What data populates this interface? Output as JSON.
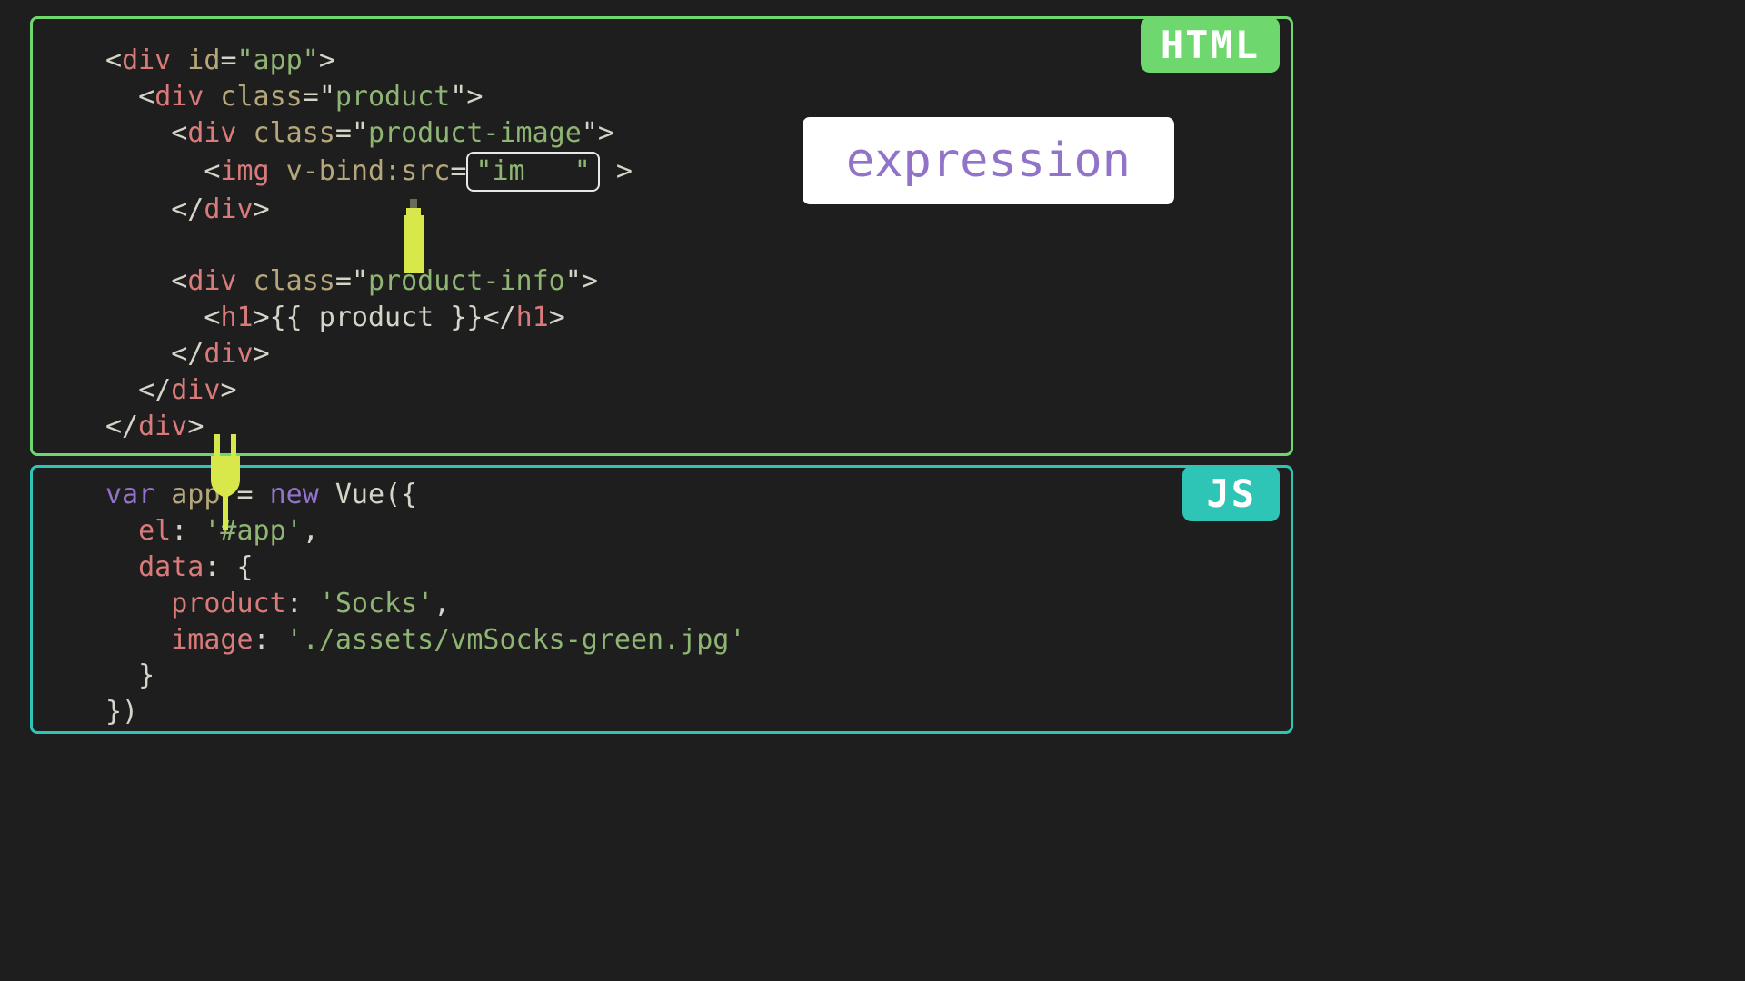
{
  "badges": {
    "html": "HTML",
    "js": "JS"
  },
  "callout": {
    "expression": "expression"
  },
  "html_code": {
    "line1": {
      "open": "<",
      "tag": "div",
      "attr": " id",
      "eq": "=",
      "val": "\"app\"",
      "close": ">"
    },
    "line2": {
      "indent": "  ",
      "open": "<",
      "tag": "div",
      "attr": " class",
      "eq": "=",
      "val_open": "\"",
      "val": "product",
      "val_close": "\"",
      "close": ">"
    },
    "line3": {
      "indent": "    ",
      "open": "<",
      "tag": "div",
      "attr": " class",
      "eq": "=",
      "val_open": "\"",
      "val": "product-image",
      "val_close": "\"",
      "close": ">"
    },
    "line4": {
      "indent": "      ",
      "open": "<",
      "tag": "img",
      "attr": " v-bind:src",
      "eq": "=",
      "box_q1": "\"",
      "box_val": "im   ",
      "box_q2": "\"",
      "close": " >"
    },
    "line5": {
      "indent": "    ",
      "open": "</",
      "tag": "div",
      "close": ">"
    },
    "line6": "",
    "line7": {
      "indent": "    ",
      "open": "<",
      "tag": "div",
      "attr": " class",
      "eq": "=",
      "val_open": "\"",
      "val": "product-info",
      "val_close": "\"",
      "close": ">"
    },
    "line8": {
      "indent": "      ",
      "open": "<",
      "tag": "h1",
      "close": ">",
      "text": "{{ product }}",
      "open2": "</",
      "tag2": "h1",
      "close2": ">"
    },
    "line9": {
      "indent": "    ",
      "open": "</",
      "tag": "div",
      "close": ">"
    },
    "line10": {
      "indent": "  ",
      "open": "</",
      "tag": "div",
      "close": ">"
    },
    "line11": {
      "open": "</",
      "tag": "div",
      "close": ">"
    }
  },
  "js_code": {
    "line1": {
      "kw": "var",
      "sp": " ",
      "var": "app",
      "rest": " = ",
      "kw2": "new",
      "sp2": " ",
      "func": "Vue",
      "paren": "({"
    },
    "line2": {
      "indent": "  ",
      "key": "el",
      "colon": ": ",
      "val": "'#app'",
      "comma": ","
    },
    "line3": {
      "indent": "  ",
      "key": "data",
      "colon": ": {",
      "comma": ""
    },
    "line4": {
      "indent": "    ",
      "key": "product",
      "colon": ": ",
      "val": "'Socks'",
      "comma": ","
    },
    "line5": {
      "indent": "    ",
      "key": "image",
      "colon": ": ",
      "val": "'./assets/vmSocks-green.jpg'"
    },
    "line6": {
      "indent": "  ",
      "close": "}"
    },
    "line7": {
      "close": "})"
    }
  }
}
